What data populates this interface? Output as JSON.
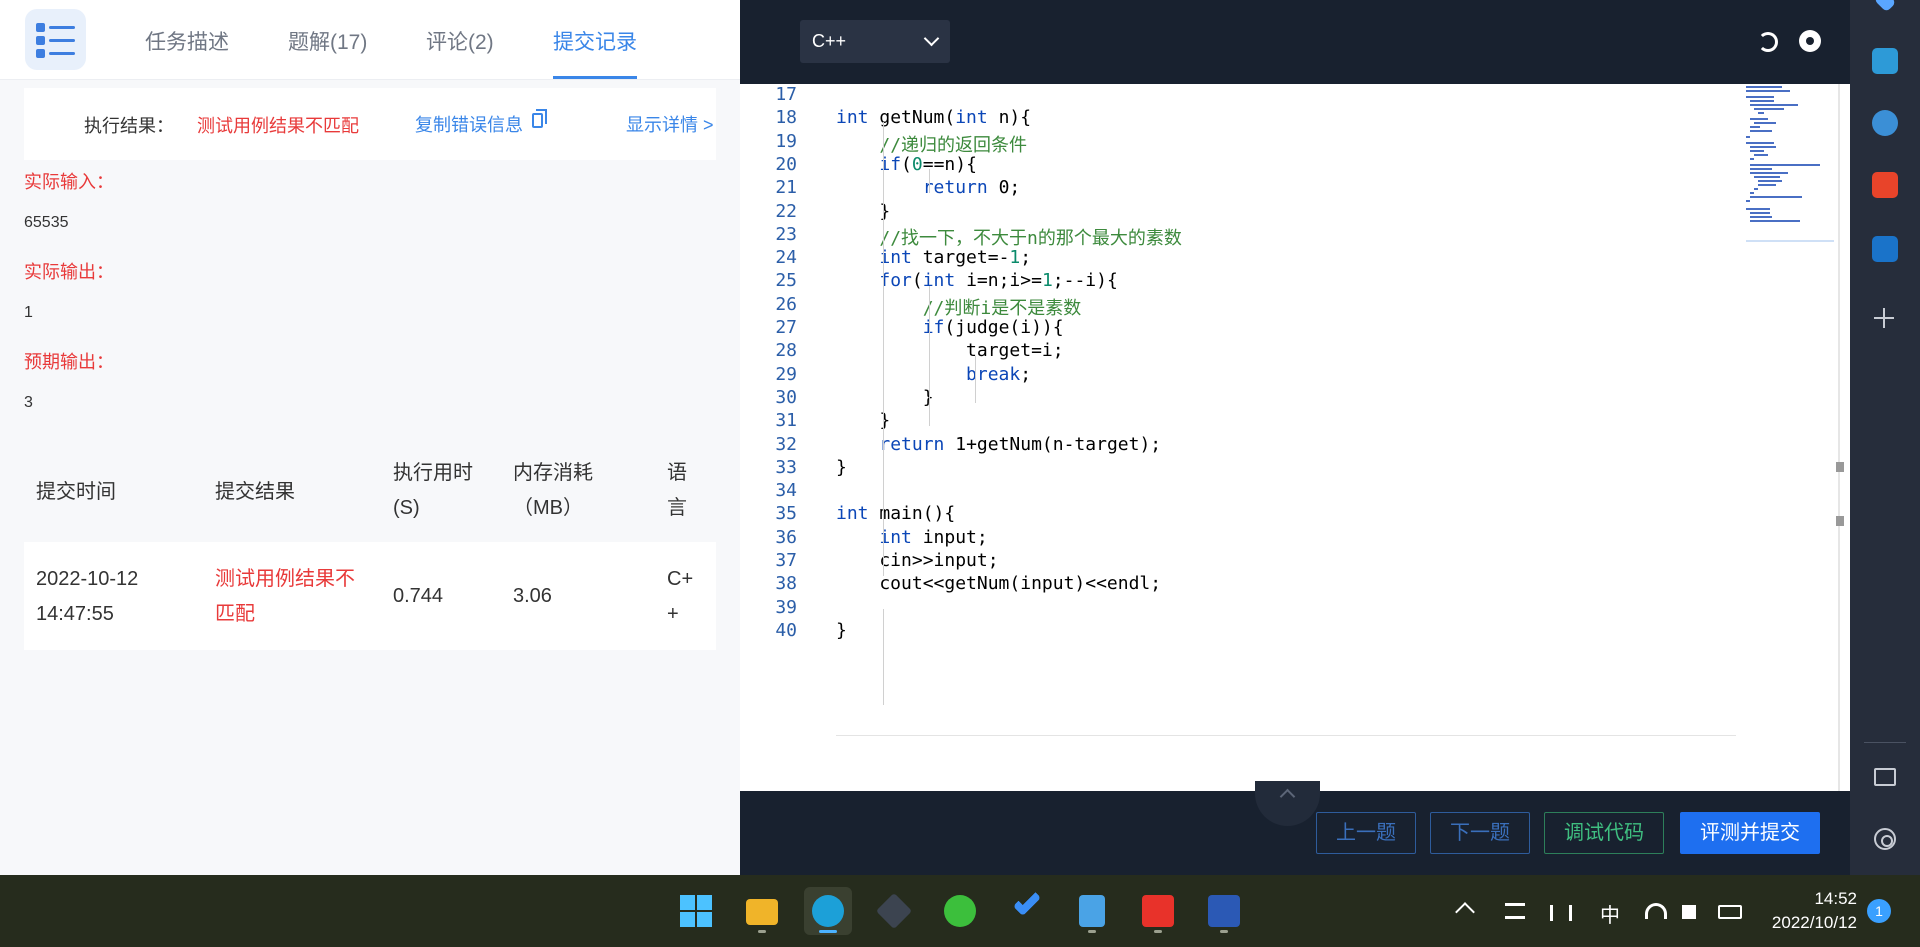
{
  "tabs": [
    {
      "label": "任务描述"
    },
    {
      "label": "题解(17)"
    },
    {
      "label": "评论(2)"
    },
    {
      "label": "提交记录"
    }
  ],
  "result": {
    "label": "执行结果：",
    "value": "测试用例结果不匹配",
    "copy_label": "复制错误信息",
    "detail_label": "显示详情 >"
  },
  "io": {
    "actual_input_label": "实际输入：",
    "actual_input_value": "65535",
    "actual_output_label": "实际输出：",
    "actual_output_value": "1",
    "expected_output_label": "预期输出：",
    "expected_output_value": "3"
  },
  "submissions": {
    "headers": [
      "提交时间",
      "提交结果",
      "执行用时\n(S)",
      "内存消耗\n（MB）",
      "语\n言"
    ],
    "rows": [
      {
        "time": "2022-10-12\n14:47:55",
        "result": "测试用例结果不\n匹配",
        "runtime": "0.744",
        "memory": "3.06",
        "language": "C+\n+"
      }
    ]
  },
  "editor": {
    "language": "C++",
    "lines": [
      {
        "n": "17",
        "code": ""
      },
      {
        "n": "18",
        "code": "int getNum(int n){"
      },
      {
        "n": "19",
        "code": "    //递归的返回条件"
      },
      {
        "n": "20",
        "code": "    if(0==n){"
      },
      {
        "n": "21",
        "code": "        return 0;"
      },
      {
        "n": "22",
        "code": "    }"
      },
      {
        "n": "23",
        "code": "    //找一下，不大于n的那个最大的素数"
      },
      {
        "n": "24",
        "code": "    int target=-1;"
      },
      {
        "n": "25",
        "code": "    for(int i=n;i>=1;--i){"
      },
      {
        "n": "26",
        "code": "        //判断i是不是素数"
      },
      {
        "n": "27",
        "code": "        if(judge(i)){"
      },
      {
        "n": "28",
        "code": "            target=i;"
      },
      {
        "n": "29",
        "code": "            break;"
      },
      {
        "n": "30",
        "code": "        }"
      },
      {
        "n": "31",
        "code": "    }"
      },
      {
        "n": "32",
        "code": "    return 1+getNum(n-target);"
      },
      {
        "n": "33",
        "code": "}"
      },
      {
        "n": "34",
        "code": ""
      },
      {
        "n": "35",
        "code": "int main(){"
      },
      {
        "n": "36",
        "code": "    int input;"
      },
      {
        "n": "37",
        "code": "    cin>>input;"
      },
      {
        "n": "38",
        "code": "    cout<<getNum(input)<<endl;"
      },
      {
        "n": "39",
        "code": ""
      },
      {
        "n": "40",
        "code": "}"
      }
    ]
  },
  "bottom": {
    "prev_label": "上一题",
    "next_label": "下一题",
    "debug_label": "调试代码",
    "submit_label": "评测并提交"
  },
  "taskbar": {
    "ime": "中",
    "time": "14:52",
    "date": "2022/10/12",
    "notification_count": "1"
  }
}
